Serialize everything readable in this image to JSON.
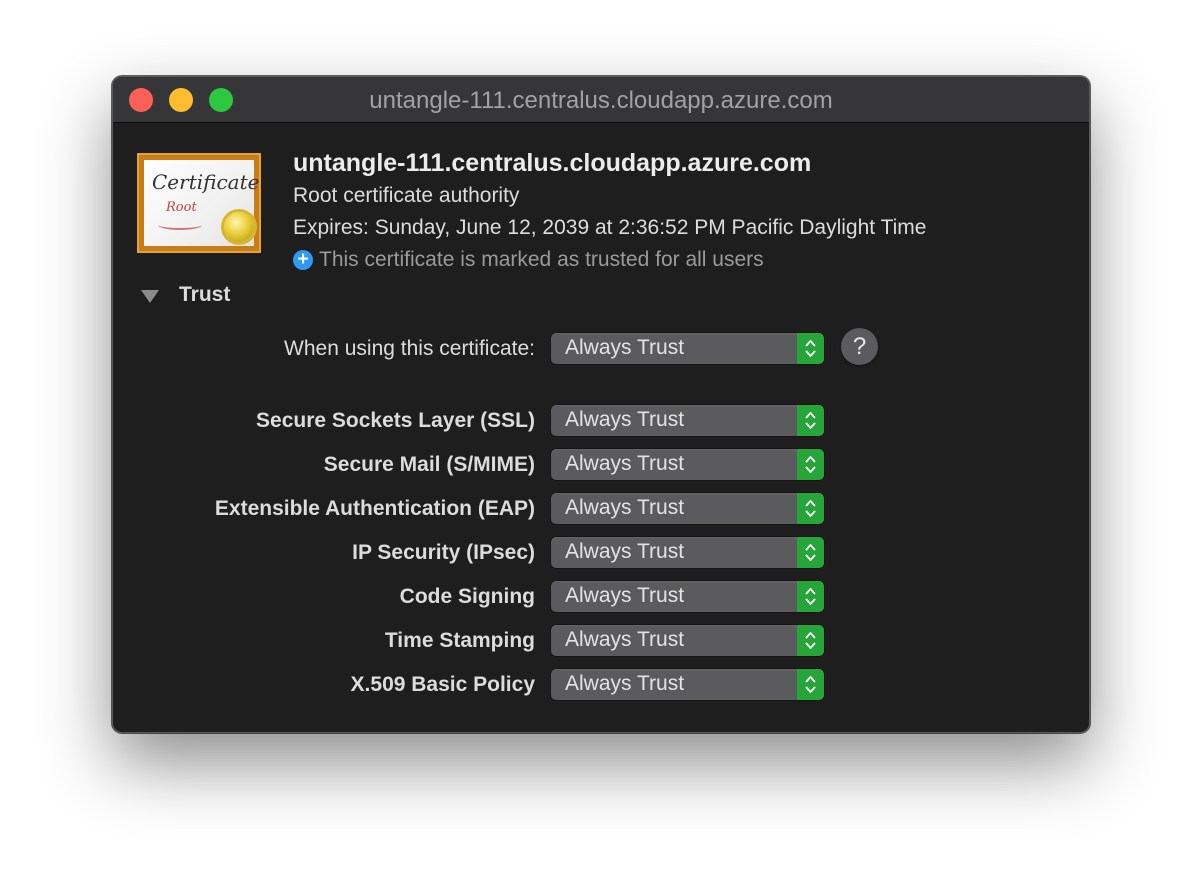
{
  "window": {
    "title": "untangle-111.centralus.cloudapp.azure.com"
  },
  "certificate": {
    "icon_word": "Certificate",
    "icon_sub": "Root",
    "name": "untangle-111.centralus.cloudapp.azure.com",
    "type": "Root certificate authority",
    "expires": "Expires: Sunday, June 12, 2039 at 2:36:52 PM Pacific Daylight Time",
    "trust_status": "This certificate is marked as trusted for all users",
    "trust_status_icon": "plus-circle-icon"
  },
  "trust": {
    "heading": "Trust",
    "when_using_label": "When using this certificate:",
    "when_using_value": "Always Trust",
    "help_label": "?",
    "rows": [
      {
        "label": "Secure Sockets Layer (SSL)",
        "value": "Always Trust"
      },
      {
        "label": "Secure Mail (S/MIME)",
        "value": "Always Trust"
      },
      {
        "label": "Extensible Authentication (EAP)",
        "value": "Always Trust"
      },
      {
        "label": "IP Security (IPsec)",
        "value": "Always Trust"
      },
      {
        "label": "Code Signing",
        "value": "Always Trust"
      },
      {
        "label": "Time Stamping",
        "value": "Always Trust"
      },
      {
        "label": "X.509 Basic Policy",
        "value": "Always Trust"
      }
    ]
  },
  "colors": {
    "close": "#fe5f57",
    "minimize": "#febc2e",
    "maximize": "#2bc840",
    "stepper": "#26a639",
    "info_blue": "#2f9af3"
  }
}
